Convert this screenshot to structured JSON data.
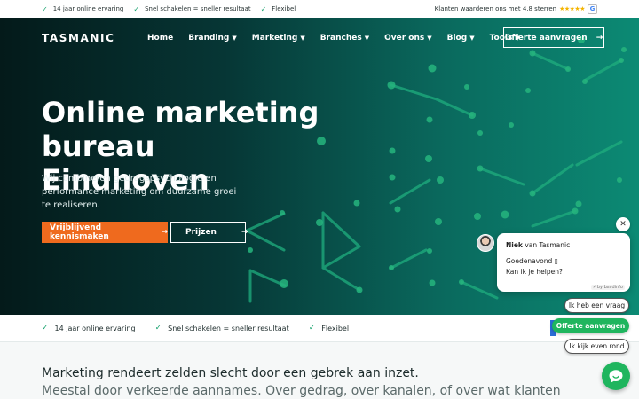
{
  "topbar": {
    "usps": [
      "14 jaar online ervaring",
      "Snel schakelen = sneller resultaat",
      "Flexibel"
    ],
    "rating_text": "Klanten waarderen ons met 4.8 sterren",
    "stars": "★★★★★",
    "google_icon": "google-icon",
    "google_letter": "G"
  },
  "header": {
    "logo": "TASMANIC",
    "nav": [
      {
        "label": "Home",
        "dropdown": false
      },
      {
        "label": "Branding",
        "dropdown": true
      },
      {
        "label": "Marketing",
        "dropdown": true
      },
      {
        "label": "Branches",
        "dropdown": true
      },
      {
        "label": "Over ons",
        "dropdown": true
      },
      {
        "label": "Blog",
        "dropdown": true
      },
      {
        "label": "Tools",
        "dropdown": true
      }
    ],
    "cta_label": "Offerte aanvragen"
  },
  "hero": {
    "title_line1": "Online marketing",
    "title_line2": "bureau Eindhoven",
    "subtitle": "Wij combineren gedragspsychologie en performance marketing om duurzame groei te realiseren.",
    "primary_button": "Vrijblijvend kennismaken",
    "secondary_button": "Prijzen",
    "arrow": "→"
  },
  "usp_bar": {
    "items": [
      "14 jaar online ervaring",
      "Snel schakelen = sneller resultaat",
      "Flexibel"
    ]
  },
  "intro": {
    "line1": "Marketing rendeert zelden slecht door een gebrek aan inzet.",
    "line2": "Meestal door verkeerde aannames. Over gedrag, over kanalen, of over wat klanten"
  },
  "chat": {
    "agent_name": "Niek",
    "agent_org": " van Tasmanic",
    "message_line1": "Goedenavond ▯",
    "message_line2": "Kan ik je helpen?",
    "powered_by": "⚡ by Leadinfo",
    "close": "✕",
    "replies": [
      "Ik heb een vraag",
      "Offerte aanvragen",
      "Ik kijk even rond"
    ]
  },
  "colors": {
    "accent_orange": "#ef6a1e",
    "accent_green": "#1fb55e",
    "check_green": "#19a36f",
    "hero_dark": "#041a1a",
    "hero_teal": "#0c8a74"
  }
}
